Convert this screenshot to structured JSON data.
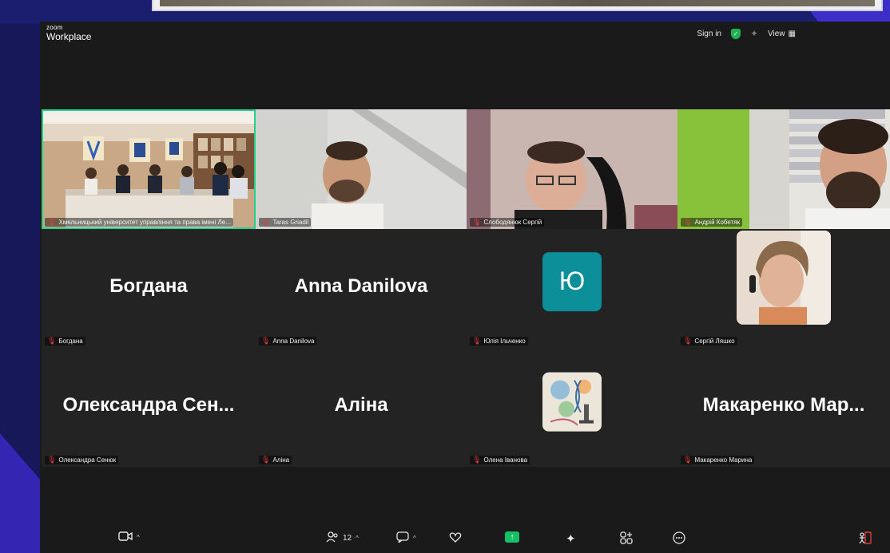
{
  "app": {
    "brand_small": "zoom",
    "brand_big": "Workplace"
  },
  "topbar": {
    "sign_in": "Sign in",
    "view": "View"
  },
  "toolbar": {
    "participants_count": "12"
  },
  "tiles": [
    {
      "type": "video",
      "label": "Хмельницький університет управління та права імені Ле...",
      "active": true
    },
    {
      "type": "video",
      "label": "Taras Griadil"
    },
    {
      "type": "video",
      "label": "Слободянюк Сергій"
    },
    {
      "type": "video",
      "label": "Андрій Кобетяк"
    },
    {
      "type": "name",
      "label": "Богдана",
      "display": "Богдана"
    },
    {
      "type": "name",
      "label": "Anna Danilova",
      "display": "Anna Danilova"
    },
    {
      "type": "letter",
      "label": "Юлія Ільченко",
      "display": "Ю"
    },
    {
      "type": "photo",
      "label": "Сергій Ляшко"
    },
    {
      "type": "name",
      "label": "Олександра Сенюк",
      "display": "Олександра  Сен..."
    },
    {
      "type": "name",
      "label": "Аліна",
      "display": "Аліна"
    },
    {
      "type": "art",
      "label": "Олена Іванова"
    },
    {
      "type": "name",
      "label": "Макаренко Марина",
      "display": "Макаренко  Мар..."
    }
  ],
  "colors": {
    "active_border": "#23d18b",
    "avatar_teal": "#0d8f9a",
    "share_green": "#16c067",
    "mute_red": "#e33b3b"
  }
}
